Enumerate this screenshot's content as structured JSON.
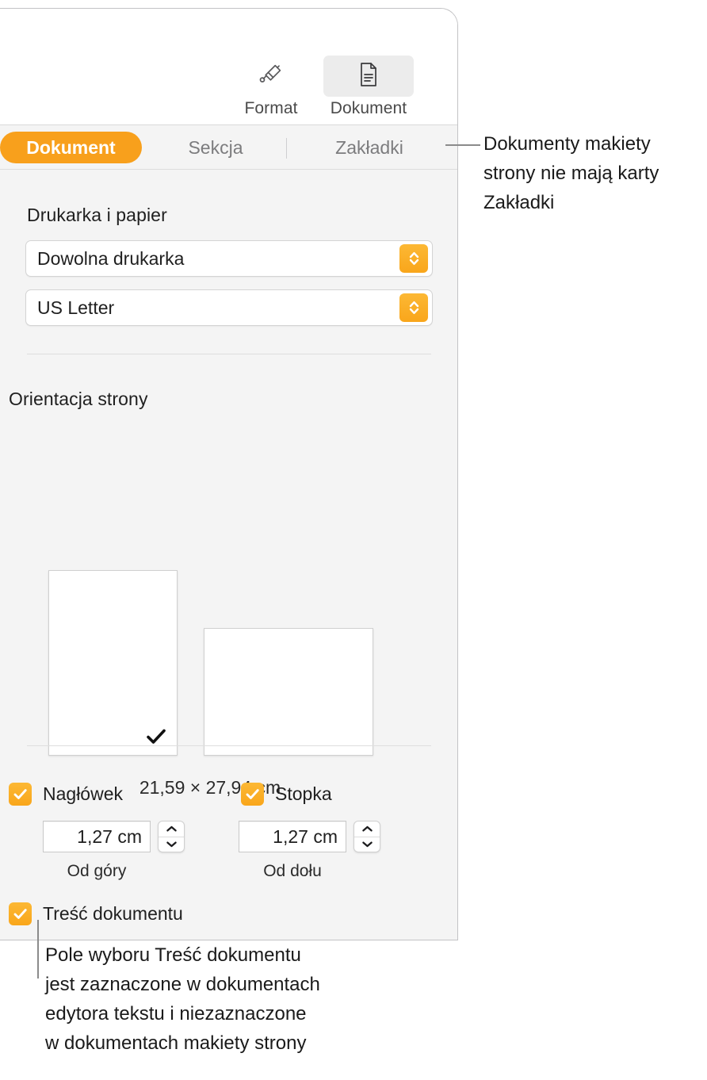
{
  "panel": {
    "toolbar": {
      "buttons": [
        {
          "label": "Format",
          "icon": "paintbrush-icon",
          "selected": false
        },
        {
          "label": "Dokument",
          "icon": "document-page-icon",
          "selected": true
        }
      ]
    },
    "tabs": [
      {
        "label": "Dokument",
        "active": true
      },
      {
        "label": "Sekcja",
        "active": false
      },
      {
        "label": "Zakładki",
        "active": false
      }
    ],
    "printer_section": {
      "title": "Drukarka i papier",
      "printer_popup": {
        "value": "Dowolna drukarka",
        "icon": "updown-chevron-icon"
      },
      "paper_popup": {
        "value": "US Letter",
        "icon": "updown-chevron-icon"
      }
    },
    "orientation_section": {
      "title": "Orientacja strony",
      "portrait": {
        "name": "portrait",
        "selected": true,
        "check_icon": "checkmark-icon"
      },
      "landscape": {
        "name": "landscape",
        "selected": false
      },
      "page_size": "21,59 × 27,94 cm"
    },
    "header_footer_section": {
      "header": {
        "checkbox_label": "Nagłówek",
        "checked": true,
        "value": "1,27 cm",
        "sublabel": "Od góry",
        "stepper_icon": "stepper-updown-icon"
      },
      "footer": {
        "checkbox_label": "Stopka",
        "checked": true,
        "value": "1,27 cm",
        "sublabel": "Od dołu",
        "stepper_icon": "stepper-updown-icon"
      },
      "body": {
        "checkbox_label": "Treść dokumentu",
        "checked": true
      }
    }
  },
  "callouts": [
    {
      "id": "tabs-callout",
      "text": "Dokumenty makiety\nstrony nie mają karty\nZakładki"
    },
    {
      "id": "body-checkbox-callout",
      "text": "Pole wyboru Treść dokumentu\njest zaznaczone w dokumentach\nedytora tekstu i niezaznaczone\nw dokumentach makiety strony"
    }
  ],
  "colors": {
    "accent_orange": "#f8a01c",
    "panel_background": "#f4f4f4",
    "toolbar_background": "#ffffff",
    "text_primary": "#1f1f1f",
    "text_muted": "#7c7c7e",
    "leader_line": "#8b8b8b"
  }
}
